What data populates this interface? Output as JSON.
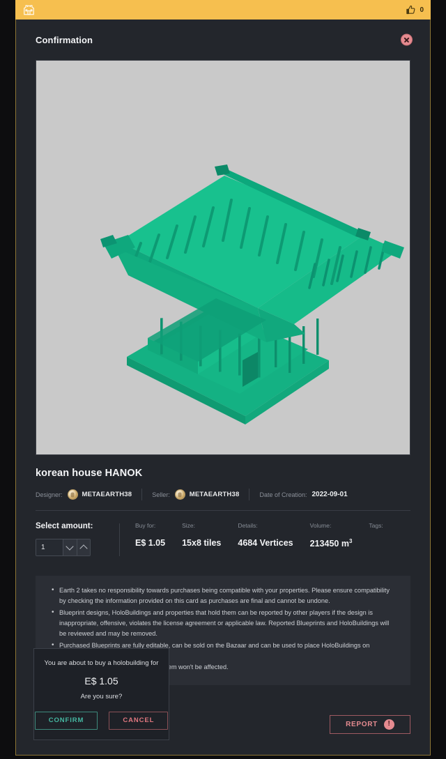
{
  "topbar": {
    "app_icon": "building-icon",
    "like_icon": "thumbs-up-icon",
    "like_count": "0"
  },
  "modal": {
    "title": "Confirmation",
    "close_icon": "close-icon"
  },
  "preview": {
    "model_name": "korean-hanok-3d-model",
    "background_color": "#c9c9c9",
    "model_color": "#16b586"
  },
  "item": {
    "title": "korean house HANOK",
    "designer_label": "Designer:",
    "designer_name": "METAEARTH38",
    "seller_label": "Seller:",
    "seller_name": "METAEARTH38",
    "date_label": "Date of Creation:",
    "date_value": "2022-09-01"
  },
  "amount": {
    "label": "Select amount:",
    "value": "1",
    "decrement_icon": "chevron-down-icon",
    "increment_icon": "chevron-up-icon"
  },
  "specs": [
    {
      "label": "Buy for:",
      "value": "E$ 1.05"
    },
    {
      "label": "Size:",
      "value": "15x8 tiles"
    },
    {
      "label": "Details:",
      "value": "4684 Vertices"
    },
    {
      "label": "Volume:",
      "value": "213450 m",
      "sup": "3"
    },
    {
      "label": "Tags:",
      "value": ""
    }
  ],
  "terms": [
    "Earth 2 takes no responsibility towards purchases being compatible with your properties. Please ensure compatibility by checking the information provided on this card as purchases are final and cannot be undone.",
    "Blueprint designs, HoloBuildings and properties that hold them can be reported by other players if the design is inappropriate, offensive, violates the license agreement or applicable law. Reported Blueprints and HoloBuildings will be reviewed and may be removed.",
    "Purchased Blueprints are fully editable, can be sold on the Bazaar and can be used to place HoloBuildings on properties.",
    "If the seller removes this design, this item won't be affected."
  ],
  "footer": {
    "report_label": "REPORT",
    "report_icon": "exclamation-icon",
    "report_badge": "!"
  },
  "confirm_popup": {
    "message": "You are about to buy a holobuilding for",
    "price": "E$ 1.05",
    "question": "Are you sure?",
    "confirm_label": "CONFIRM",
    "cancel_label": "CANCEL"
  },
  "colors": {
    "accent_gold": "#f6bf4f",
    "modal_bg": "#23262c",
    "terms_bg": "#2b2e35",
    "confirm_teal": "#45b8a2",
    "cancel_red": "#e0777f",
    "border_gold": "#8d7535"
  }
}
